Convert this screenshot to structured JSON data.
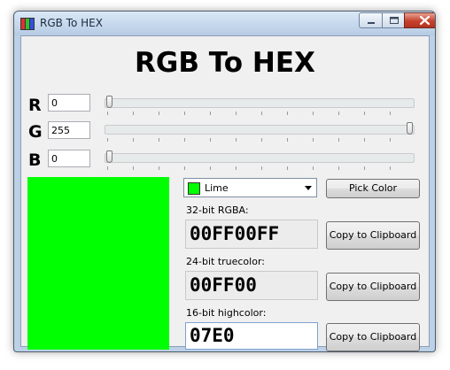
{
  "window": {
    "title": "RGB To HEX"
  },
  "heading": "RGB To HEX",
  "channels": [
    {
      "label": "R",
      "value": "0",
      "level": 0
    },
    {
      "label": "G",
      "value": "255",
      "level": 1
    },
    {
      "label": "B",
      "value": "0",
      "level": 0
    }
  ],
  "color_select": {
    "selected": "Lime",
    "swatch_color": "#00ff00"
  },
  "pick_button": "Pick Color",
  "preview_color": "#00ff00",
  "outputs": [
    {
      "caption": "32-bit RGBA:",
      "value": "00FF00FF",
      "copy_label": "Copy to Clipboard"
    },
    {
      "caption": "24-bit truecolor:",
      "value": "00FF00",
      "copy_label": "Copy to Clipboard"
    },
    {
      "caption": "16-bit highcolor:",
      "value": "07E0",
      "copy_label": "Copy to Clipboard"
    }
  ],
  "icons": [
    "app-icon",
    "minimize-icon",
    "maximize-icon",
    "close-icon",
    "chevron-down-icon"
  ]
}
